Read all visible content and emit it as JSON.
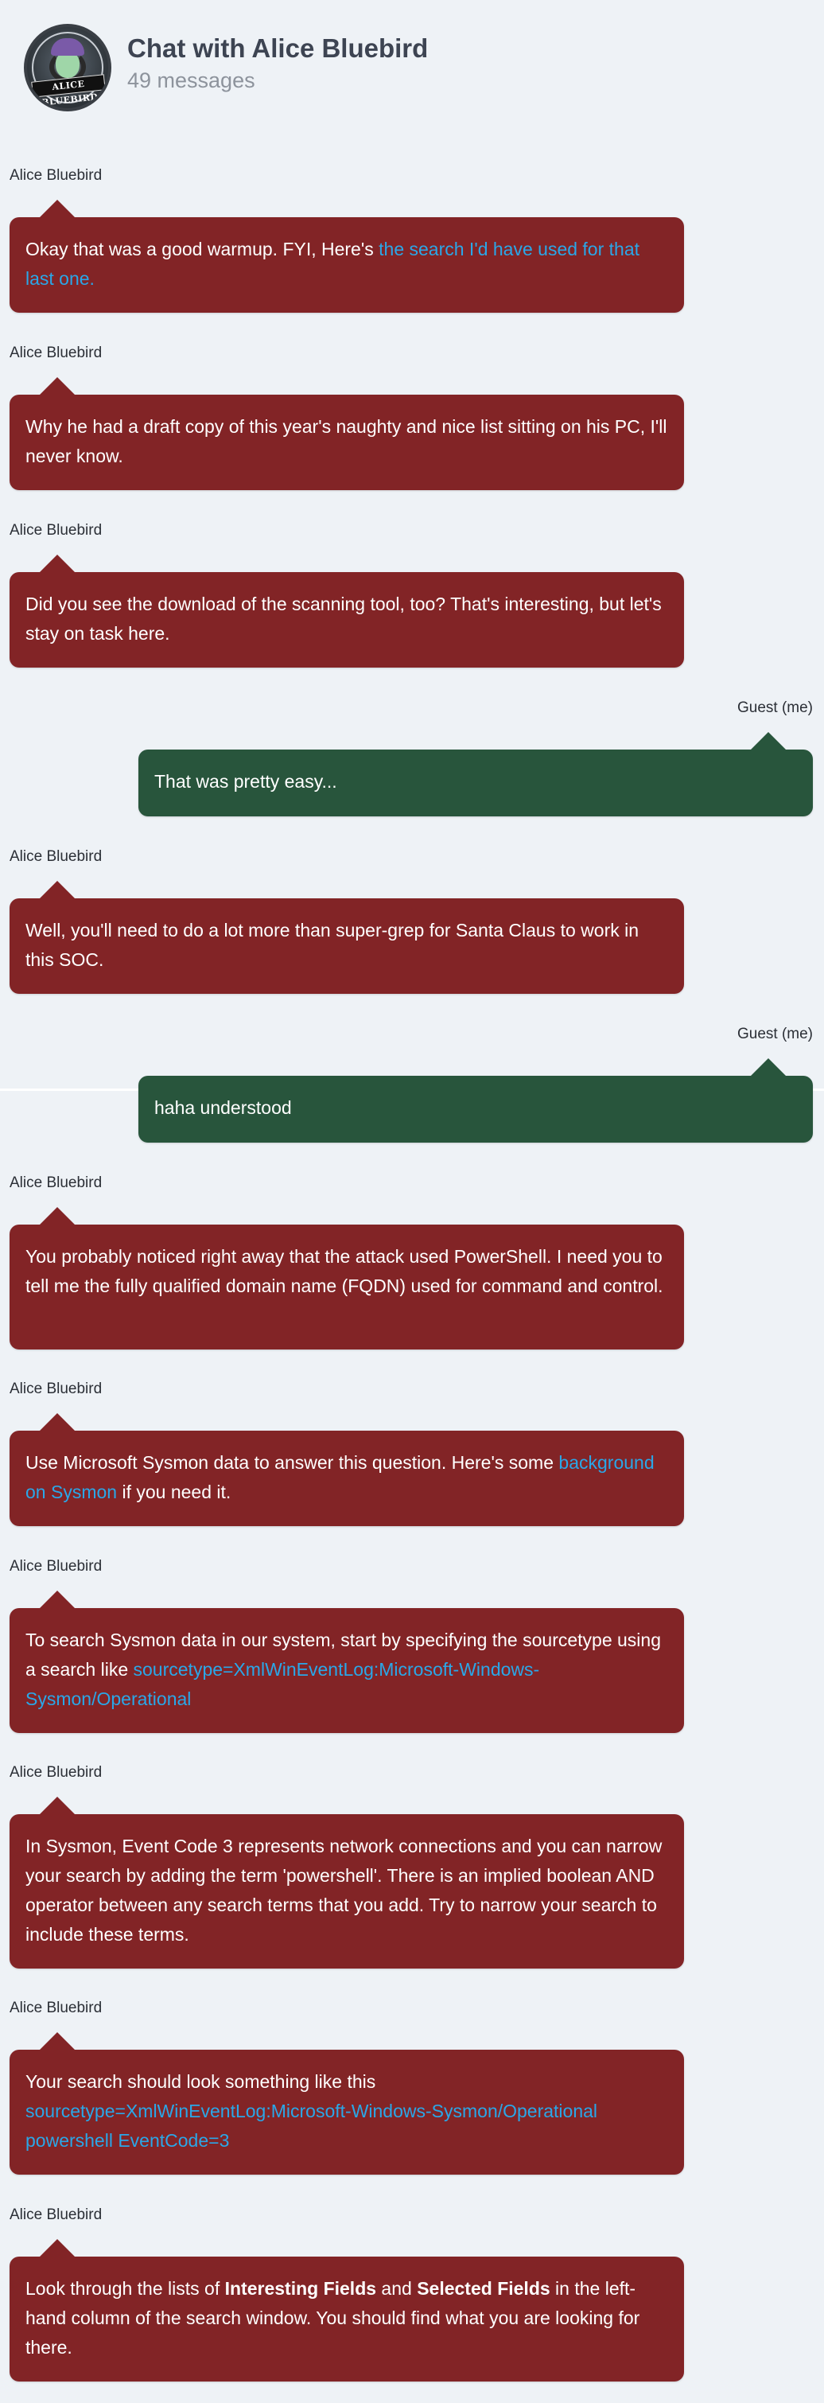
{
  "header": {
    "title": "Chat with Alice Bluebird",
    "subtitle": "49 messages",
    "avatar_banner": "ALICE BLUEBIRD"
  },
  "messages": [
    {
      "sender": "Alice Bluebird",
      "text_before": "Okay that was a good warmup. FYI, Here's ",
      "link": "the search I'd have used for that last one.",
      "text_after": ""
    },
    {
      "sender": "Alice Bluebird",
      "text": "Why he had a draft copy of this year's naughty and nice list sitting on his PC, I'll never know."
    },
    {
      "sender": "Alice Bluebird",
      "text": "Did you see the download of the scanning tool, too? That's interesting, but let's stay on task here."
    },
    {
      "sender": "Guest (me)",
      "text": "That was pretty easy..."
    },
    {
      "sender": "Alice Bluebird",
      "text": "Well, you'll need to do a lot more than super-grep for Santa Claus to work in this SOC."
    },
    {
      "sender": "Guest (me)",
      "text": "haha understood"
    },
    {
      "sender": "Alice Bluebird",
      "text": "You probably noticed right away that the attack used PowerShell. I need you to tell me the fully qualified domain name (FQDN) used for command and control."
    },
    {
      "sender": "Alice Bluebird",
      "text_before": "Use Microsoft Sysmon data to answer this question. Here's some ",
      "link": "background on Sysmon",
      "text_after": " if you need it."
    },
    {
      "sender": "Alice Bluebird",
      "text_before": "To search Sysmon data in our system, start by specifying the sourcetype using a search like ",
      "link": "sourcetype=XmlWinEventLog:Microsoft-Windows-Sysmon/Operational",
      "text_after": ""
    },
    {
      "sender": "Alice Bluebird",
      "text": "In Sysmon, Event Code 3 represents network connections and you can narrow your search by adding the term 'powershell'. There is an implied boolean AND operator between any search terms that you add. Try to narrow your search to include these terms."
    },
    {
      "sender": "Alice Bluebird",
      "text_before": "Your search should look something like this ",
      "link": "sourcetype=XmlWinEventLog:Microsoft-Windows-Sysmon/Operational powershell EventCode=3",
      "text_after": ""
    },
    {
      "sender": "Alice Bluebird",
      "text_1": "Look through the lists of ",
      "bold_1": "Interesting Fields",
      "text_2": " and ",
      "bold_2": "Selected Fields",
      "text_3": " in the left-hand column of the search window. You should find what you are looking for there."
    }
  ],
  "colors": {
    "alice_bubble": "#822426",
    "me_bubble": "#28553c",
    "link": "#2aa7e8",
    "background": "#eef2f6"
  }
}
